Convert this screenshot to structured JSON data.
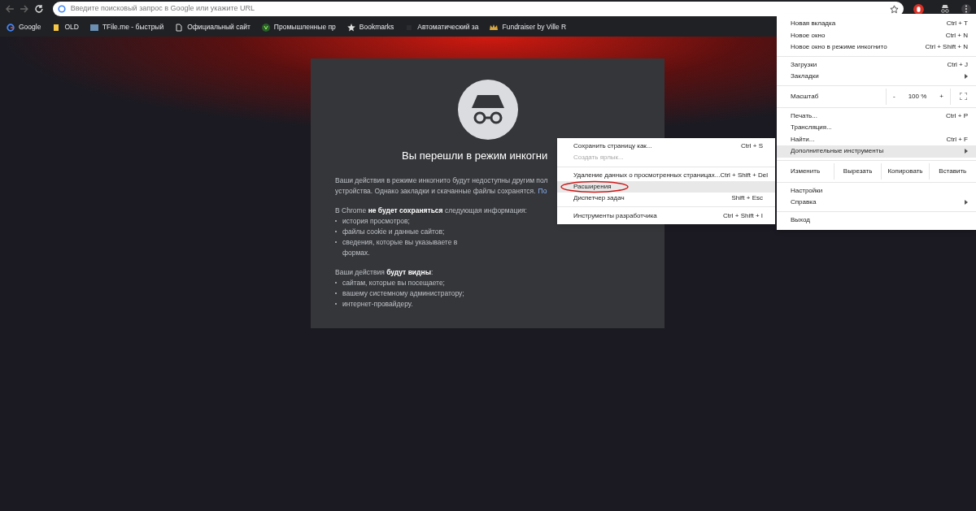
{
  "toolbar": {
    "address_placeholder": "Введите поисковый запрос в Google или укажите URL"
  },
  "bookmarks": [
    {
      "label": "Google",
      "kind": "google"
    },
    {
      "label": "OLD",
      "kind": "folder"
    },
    {
      "label": "TFile.me - быстрый",
      "kind": "tile"
    },
    {
      "label": "Официальный сайт",
      "kind": "page"
    },
    {
      "label": "Промышленные пр",
      "kind": "check"
    },
    {
      "label": "Bookmarks",
      "kind": "star"
    },
    {
      "label": "Автоматический за",
      "kind": "blank"
    },
    {
      "label": "Fundraiser by Ville R",
      "kind": "crown"
    }
  ],
  "incognito_page": {
    "title": "Вы перешли в режим инкогни",
    "intro_lines": [
      "Ваши действия в режиме инкогнито будут недоступны другим пол",
      "устройства. Однако закладки и скачанные файлы сохранятся."
    ],
    "intro_link": "По",
    "not_saved_heading": "В Chrome **не будет сохраняться** следующая информация:",
    "not_saved_items": [
      "история просмотров;",
      "файлы cookie и данные сайтов;",
      "сведения, которые вы указываете в формах."
    ],
    "visible_heading": "Ваши действия **будут видны**:",
    "visible_items": [
      "сайтам, которые вы посещаете;",
      "вашему системному администратору;",
      "интернет-провайдеру."
    ]
  },
  "main_menu": [
    [
      {
        "kind": "item",
        "label": "Новая вкладка",
        "shortcut": "Ctrl + T",
        "highlighted": false
      },
      {
        "kind": "item",
        "label": "Новое окно",
        "shortcut": "Ctrl + N",
        "highlighted": false
      },
      {
        "kind": "item",
        "label": "Новое окно в режиме инкогнито",
        "shortcut": "Ctrl + Shift + N",
        "highlighted": false
      }
    ],
    [
      {
        "kind": "item",
        "label": "Загрузки",
        "shortcut": "Ctrl + J",
        "highlighted": false
      },
      {
        "kind": "submenu",
        "label": "Закладки",
        "highlighted": false
      }
    ],
    [
      {
        "kind": "zoom",
        "label": "Масштаб",
        "minus": "-",
        "value": "100 %",
        "plus": "+"
      }
    ],
    [
      {
        "kind": "item",
        "label": "Печать...",
        "shortcut": "Ctrl + P",
        "highlighted": false
      },
      {
        "kind": "item",
        "label": "Трансляция...",
        "highlighted": false
      },
      {
        "kind": "item",
        "label": "Найти...",
        "shortcut": "Ctrl + F",
        "highlighted": false
      },
      {
        "kind": "submenu",
        "label": "Дополнительные инструменты",
        "highlighted": true
      }
    ],
    [
      {
        "kind": "edit",
        "label": "Изменить",
        "buttons": [
          "Вырезать",
          "Копировать",
          "Вставить"
        ]
      }
    ],
    [
      {
        "kind": "item",
        "label": "Настройки",
        "highlighted": false
      },
      {
        "kind": "submenu",
        "label": "Справка",
        "highlighted": false
      }
    ],
    [
      {
        "kind": "item",
        "label": "Выход",
        "highlighted": false
      }
    ]
  ],
  "tools_submenu": [
    [
      {
        "label": "Сохранить страницу как...",
        "shortcut": "Ctrl + S",
        "disabled": false,
        "highlighted": false,
        "circled": false
      },
      {
        "label": "Создать ярлык...",
        "disabled": true,
        "highlighted": false,
        "circled": false
      }
    ],
    [
      {
        "label": "Удаление данных о просмотренных страницах...",
        "shortcut": "Ctrl + Shift + Del",
        "disabled": false,
        "highlighted": false,
        "circled": false
      },
      {
        "label": "Расширения",
        "disabled": false,
        "highlighted": true,
        "circled": true
      },
      {
        "label": "Диспетчер задач",
        "shortcut": "Shift + Esc",
        "disabled": false,
        "highlighted": false,
        "circled": false
      }
    ],
    [
      {
        "label": "Инструменты разработчика",
        "shortcut": "Ctrl + Shift + I",
        "disabled": false,
        "highlighted": false,
        "circled": false
      }
    ]
  ]
}
